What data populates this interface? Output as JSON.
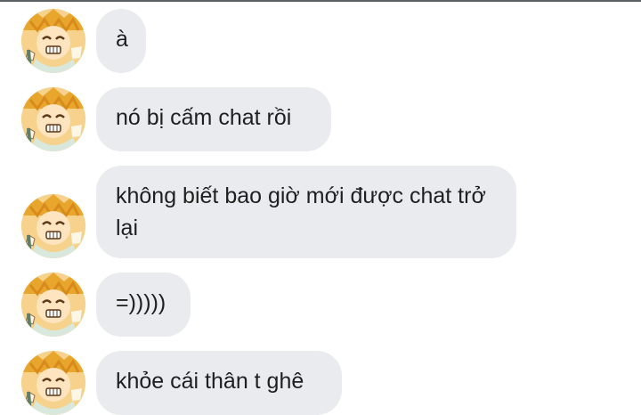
{
  "messages": [
    {
      "text": "à",
      "avatar_icon": "anime-boy-avatar-icon"
    },
    {
      "text": "nó bị cấm chat rồi",
      "avatar_icon": "anime-boy-avatar-icon"
    },
    {
      "text": "không biết bao giờ mới được chat trở lại",
      "avatar_icon": "anime-boy-avatar-icon"
    },
    {
      "text": "=)))))",
      "avatar_icon": "anime-boy-avatar-icon"
    },
    {
      "text": "khỏe cái thân t ghê",
      "avatar_icon": "anime-boy-avatar-icon"
    }
  ],
  "colors": {
    "bubble_bg": "#e9ebef",
    "text": "#1f1f1f",
    "divider": "#5b5f66"
  }
}
